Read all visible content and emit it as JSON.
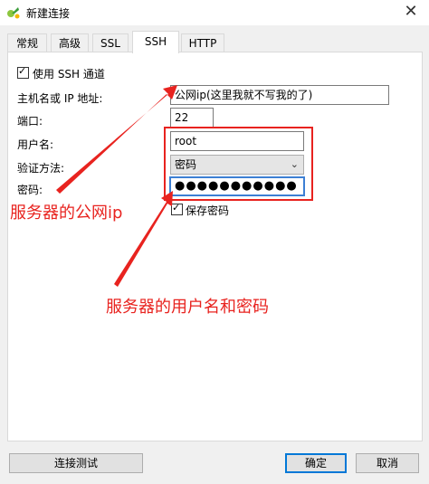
{
  "window": {
    "title": "新建连接",
    "close_symbol": "✕"
  },
  "tabs": [
    {
      "label": "常规",
      "active": false
    },
    {
      "label": "高级",
      "active": false
    },
    {
      "label": "SSL",
      "active": false
    },
    {
      "label": "SSH",
      "active": true
    },
    {
      "label": "HTTP",
      "active": false
    }
  ],
  "ssh": {
    "use_ssh_label": "使用 SSH 通道",
    "use_ssh_checked": true,
    "host_label": "主机名或 IP 地址:",
    "host_value": "公网ip(这里我就不写我的了)",
    "port_label": "端口:",
    "port_value": "22",
    "username_label": "用户名:",
    "username_value": "root",
    "auth_label": "验证方法:",
    "auth_value": "密码",
    "password_label": "密码:",
    "password_value": "●●●●●●●●●●●",
    "save_password_label": "保存密码",
    "save_password_checked": true
  },
  "annotations": {
    "server_ip": "服务器的公网ip",
    "server_credentials": "服务器的用户名和密码",
    "color": "#e8231f"
  },
  "buttons": {
    "test_label": "连接测试",
    "ok_label": "确定",
    "cancel_label": "取消"
  },
  "icons": {
    "app": "navicat-icon",
    "check": "checkmark-icon",
    "dropdown": "chevron-down-icon"
  }
}
